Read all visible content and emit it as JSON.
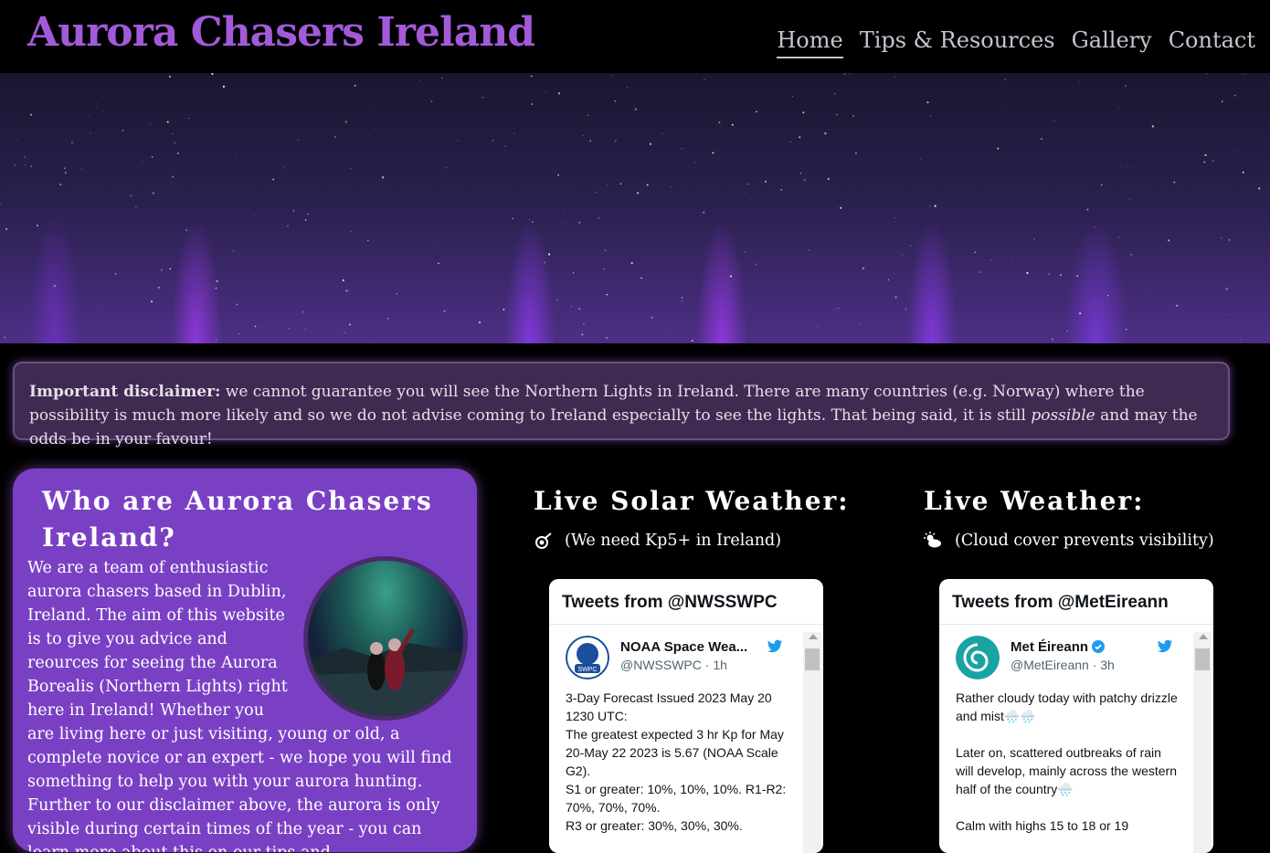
{
  "site": {
    "title": "Aurora Chasers Ireland"
  },
  "nav": [
    {
      "label": "Home",
      "active": true
    },
    {
      "label": "Tips & Resources",
      "active": false
    },
    {
      "label": "Gallery",
      "active": false
    },
    {
      "label": "Contact",
      "active": false
    }
  ],
  "disclaimer": {
    "bold": "Important disclaimer:",
    "text_before": " we cannot guarantee you will see the Northern Lights in Ireland. There are many countries (e.g. Norway) where the possibility is much more likely and so we do not advise coming to Ireland especially to see the lights. That being said, it is still ",
    "italic": "possible",
    "text_after": " and may the odds be in your favour!"
  },
  "about": {
    "heading": "Who are Aurora Chasers Ireland?",
    "body": "We are a team of enthusiastic aurora chasers based in Dublin, Ireland. The aim of this website is to give you advice and reources for seeing the Aurora Borealis (Northern Lights) right here in Ireland! Whether you are living here or just visiting, young or old, a complete novice or an expert - we hope you will find something to help you with your aurora hunting. Further to our disclaimer above, the aurora is only visible during certain times of the year - you can learn more about this on our ",
    "link": "tips and"
  },
  "solar": {
    "heading": "Live Solar Weather:",
    "note": "(We need Kp5+ in Ireland)",
    "icon": "comet-icon",
    "widget": {
      "title": "Tweets from @NWSSWPC",
      "name": "NOAA Space Wea...",
      "handle": "@NWSSWPC · 1h",
      "text": "3-Day Forecast Issued 2023 May 20 1230 UTC:\nThe greatest expected 3 hr Kp for May 20-May 22 2023 is 5.67 (NOAA Scale G2).\nS1 or greater: 10%, 10%, 10%. R1-R2: 70%, 70%, 70%.\nR3 or greater: 30%, 30%, 30%."
    }
  },
  "weather": {
    "heading": "Live Weather:",
    "note": "(Cloud cover prevents visibility)",
    "icon": "cloud-sun-icon",
    "widget": {
      "title": "Tweets from @MetEireann",
      "name": "Met Éireann",
      "handle": "@MetEireann · 3h",
      "text": "Rather cloudy today with patchy drizzle and mist🌧️🌧️\n\nLater on, scattered outbreaks of rain will develop, mainly across the western half of the country🌧️\n\nCalm with highs 15 to 18 or 19"
    }
  },
  "colors": {
    "accent": "#a25ad8",
    "panel": "#7a40c4",
    "disclaimer_bg": "#3f2a52"
  }
}
